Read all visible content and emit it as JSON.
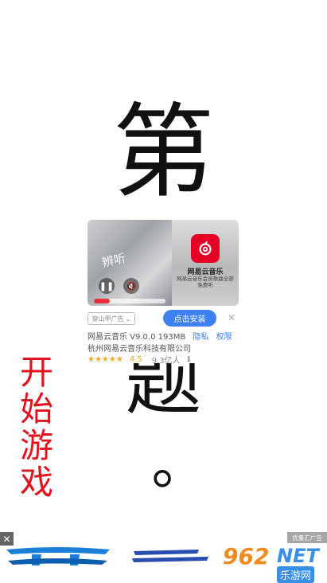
{
  "page": {
    "char_top": "第",
    "char_mid": "题",
    "char_dot": "。",
    "start_chars": [
      "开",
      "始",
      "游",
      "戏"
    ]
  },
  "ad": {
    "video_title": "辨听",
    "app_name_in_shot": "网易云音乐",
    "app_slogan_in_shot": "网易云音乐会员歌曲全部免费听",
    "tag": "穿山甲广告",
    "install_button": "点击安装",
    "app_info": "网易云音乐 V9.0.0 193MB",
    "privacy": "隐私",
    "permissions": "权限",
    "developer": "杭州网易云音乐科技有限公司",
    "stars": "★★★★★",
    "rating": "4.5",
    "downloads": "9.3亿人",
    "brand_color": "#e60026",
    "accent_color": "#3e80f0"
  },
  "banner": {
    "ad_tag": "优量汇广告",
    "watermark_num": "962",
    "watermark_net": "NET",
    "watermark_site": "乐游网"
  },
  "icons": {
    "pause": "pause-icon",
    "mute": "mute-icon",
    "close": "close-icon",
    "download": "download-icon",
    "chevron": "chevron-down-icon"
  }
}
